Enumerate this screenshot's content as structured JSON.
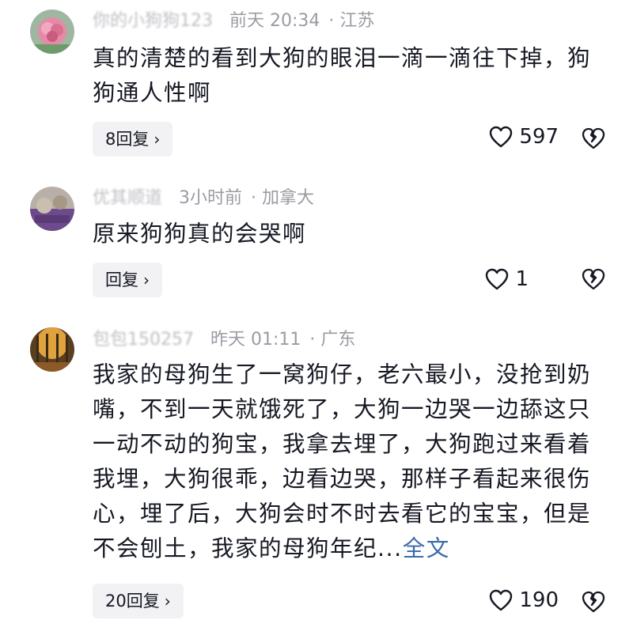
{
  "comments": [
    {
      "username": "你的小狗狗123",
      "time": "前天 20:34",
      "location": "江苏",
      "text": "真的清楚的看到大狗的眼泪一滴一滴往下掉，狗狗通人性啊",
      "replies_label": "8回复",
      "likes": "597"
    },
    {
      "username": "优其顺道",
      "time": "3小时前",
      "location": "加拿大",
      "text": "原来狗狗真的会哭啊",
      "replies_label": "回复",
      "likes": "1"
    },
    {
      "username": "包包150257",
      "time": "昨天 01:11",
      "location": "广东",
      "text": "我家的母狗生了一窝狗仔，老六最小，没抢到奶嘴，不到一天就饿死了，大狗一边哭一边舔这只一动不动的狗宝，我拿去埋了，大狗跑过来看着我埋，大狗很乖，边看边哭，那样子看起来很伤心，埋了后，大狗会时不时去看它的宝宝，但是不会刨土，我家的母狗年纪...",
      "more_label": "全文",
      "replies_label": "20回复",
      "likes": "190"
    }
  ],
  "separator": "·",
  "chevron": "›",
  "icons": {
    "like": "heart-outline-icon",
    "dislike": "broken-heart-icon"
  }
}
